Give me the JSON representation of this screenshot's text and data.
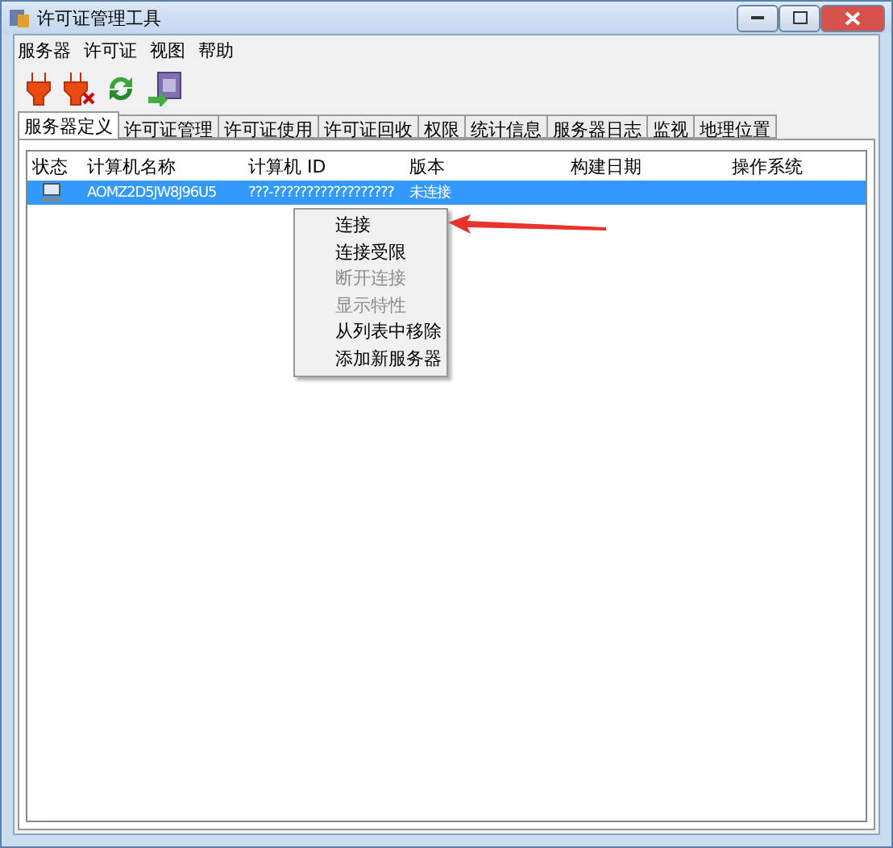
{
  "window": {
    "title": "许可证管理工具"
  },
  "menu_bar": [
    "服务器",
    "许可证",
    "视图",
    "帮助"
  ],
  "tabs": [
    {
      "label": "服务器定义",
      "selected": true
    },
    {
      "label": "许可证管理",
      "selected": false
    },
    {
      "label": "许可证使用",
      "selected": false
    },
    {
      "label": "许可证回收",
      "selected": false
    },
    {
      "label": "权限",
      "selected": false
    },
    {
      "label": "统计信息",
      "selected": false
    },
    {
      "label": "服务器日志",
      "selected": false
    },
    {
      "label": "监视",
      "selected": false
    },
    {
      "label": "地理位置",
      "selected": false
    }
  ],
  "table": {
    "columns": [
      "状态",
      "计算机名称",
      "计算机 ID",
      "版本",
      "构建日期",
      "操作系统"
    ],
    "rows": [
      {
        "selected": true,
        "name": "AOMZ2D5JW8J96U5",
        "id": "???-??????????????????",
        "version": "未连接"
      }
    ]
  },
  "context_menu": [
    {
      "label": "连接",
      "disabled": false
    },
    {
      "label": "连接受限",
      "disabled": false
    },
    {
      "label": "断开连接",
      "disabled": true
    },
    {
      "label": "显示特性",
      "disabled": true
    },
    {
      "label": "从列表中移除",
      "disabled": false
    },
    {
      "label": "添加新服务器",
      "disabled": false
    }
  ]
}
